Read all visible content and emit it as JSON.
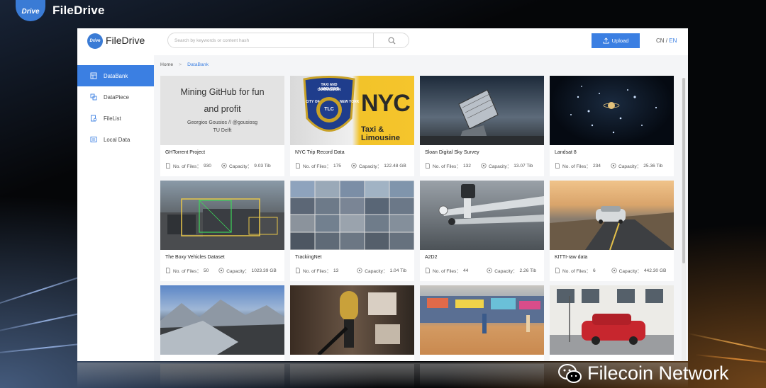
{
  "top_brand": {
    "logo_text": "Drive",
    "title": "FileDrive"
  },
  "header": {
    "logo_text": "Drive",
    "title": "FileDrive",
    "search_placeholder": "Search by keywords or content hash",
    "upload_label": "Upload",
    "lang_cn": "CN",
    "lang_sep": " / ",
    "lang_en": "EN"
  },
  "sidebar": {
    "items": [
      {
        "label": "DataBank",
        "icon": "databank-icon",
        "active": true
      },
      {
        "label": "DataPiece",
        "icon": "datapiece-icon",
        "active": false
      },
      {
        "label": "FileList",
        "icon": "filelist-icon",
        "active": false
      },
      {
        "label": "Local Data",
        "icon": "local-data-icon",
        "active": false
      }
    ]
  },
  "breadcrumb": {
    "home": "Home",
    "sep": ">",
    "current": "DataBank"
  },
  "meta_labels": {
    "files": "No. of Files：",
    "capacity": "Capacity："
  },
  "cards": [
    {
      "title": "GHTorrent Project",
      "files": "930",
      "capacity": "9.03 Tib",
      "cover": {
        "line1": "Mining GitHub for fun",
        "line2": "and profit",
        "line3": "Georgios Gousios // @gousiosg",
        "line4": "TU Delft"
      }
    },
    {
      "title": "NYC Trip Record Data",
      "files": "175",
      "capacity": "122.48 GB",
      "cover": {
        "seal_top": "TAXI AND LIMOUSINE",
        "seal_mid": "COMMISSION",
        "seal_left": "CITY OF",
        "seal_right": "NEW YORK",
        "seal_center": "TLC",
        "sign_big": "NYC",
        "sign_small": "Taxi & Limousine"
      }
    },
    {
      "title": "Sloan Digital Sky Survey",
      "files": "132",
      "capacity": "13.07 Tib"
    },
    {
      "title": "Landsat 8",
      "files": "234",
      "capacity": "25.36 Tib"
    },
    {
      "title": "The Boxy Vehicles Dataset",
      "files": "50",
      "capacity": "1023.39 GB"
    },
    {
      "title": "TrackingNet",
      "files": "13",
      "capacity": "1.04 Tib"
    },
    {
      "title": "A2D2",
      "files": "44",
      "capacity": "2.26 Tib"
    },
    {
      "title": "KITTI-raw data",
      "files": "6",
      "capacity": "442.30 GB"
    }
  ],
  "watermark": {
    "text": "Filecoin Network",
    "icon": "wechat-icon"
  },
  "colors": {
    "accent": "#3b7fe2",
    "brand": "#3a7bd5"
  }
}
